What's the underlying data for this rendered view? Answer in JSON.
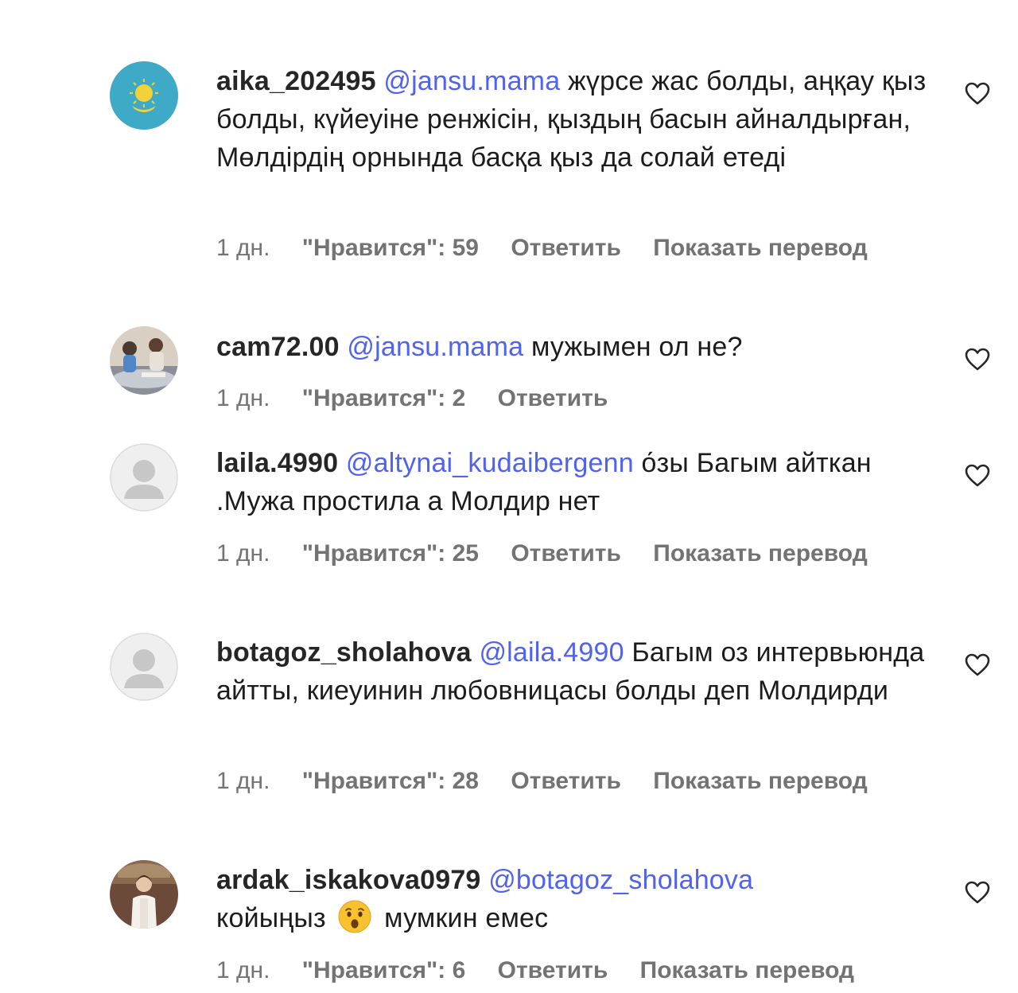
{
  "comments": [
    {
      "username": "aika_202495",
      "mention": "@jansu.mama",
      "text": "жүрсе жас болды, аңқау қыз болды, күйеуіне ренжісін, қыздың басын айналдырған, Мөлдірдің орнында басқа қыз да солай етеді",
      "time": "1 дн.",
      "likes": "\"Нравится\": 59",
      "reply": "Ответить",
      "translate": "Показать перевод",
      "avatar": "kazakhstan-flag"
    },
    {
      "username": "cam72.00",
      "mention": "@jansu.mama",
      "text": "мужымен ол не?",
      "time": "1 дн.",
      "likes": "\"Нравится\": 2",
      "reply": "Ответить",
      "avatar": "photo-children"
    },
    {
      "username": "laila.4990",
      "mention": "@altynai_kudaibergenn",
      "text": "о́зы Багым айткан .Мужа простила а Молдир нет",
      "time": "1 дн.",
      "likes": "\"Нравится\": 25",
      "reply": "Ответить",
      "translate": "Показать перевод",
      "avatar": "default-user"
    },
    {
      "username": "botagoz_sholahova",
      "mention": "@laila.4990",
      "text": "Багым оз интервьюнда айтты, киеуинин любовницасы болды деп Молдирди",
      "time": "1 дн.",
      "likes": "\"Нравится\": 28",
      "reply": "Ответить",
      "translate": "Показать перевод",
      "avatar": "default-user"
    },
    {
      "username": "ardak_iskakova0979",
      "mention": "@botagoz_sholahova",
      "text_before_emoji": "койыңыз",
      "emoji": "surprised-face-emoji",
      "text_after_emoji": "мумкин емес",
      "time": "1 дн.",
      "likes": "\"Нравится\": 6",
      "reply": "Ответить",
      "translate": "Показать перевод",
      "avatar": "photo-woman"
    }
  ],
  "colors": {
    "mention": "#5062f0",
    "meta": "#737373",
    "text": "#1c1c1c"
  }
}
